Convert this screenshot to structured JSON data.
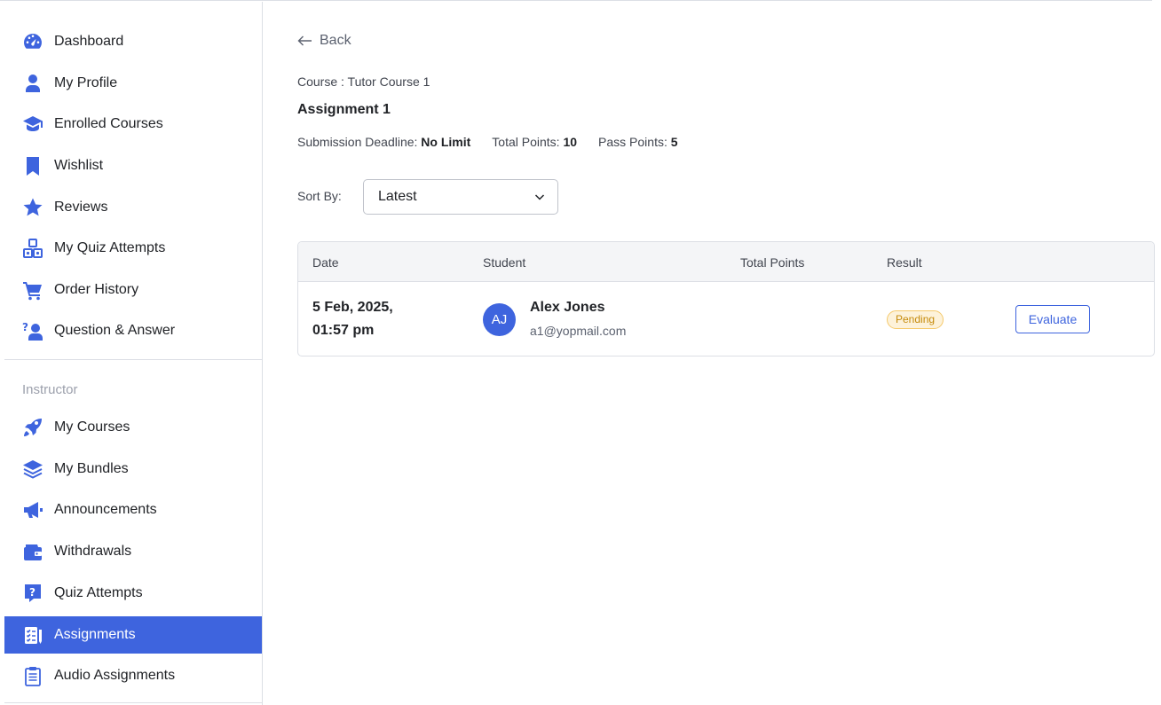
{
  "sidebar": {
    "items": [
      {
        "label": "Dashboard",
        "icon": "dashboard-gauge-icon"
      },
      {
        "label": "My Profile",
        "icon": "user-icon"
      },
      {
        "label": "Enrolled Courses",
        "icon": "graduation-cap-icon"
      },
      {
        "label": "Wishlist",
        "icon": "bookmark-icon"
      },
      {
        "label": "Reviews",
        "icon": "star-icon"
      },
      {
        "label": "My Quiz Attempts",
        "icon": "quiz-blocks-icon"
      },
      {
        "label": "Order History",
        "icon": "cart-icon"
      },
      {
        "label": "Question & Answer",
        "icon": "question-person-icon"
      }
    ],
    "section_label": "Instructor",
    "instructor_items": [
      {
        "label": "My Courses",
        "icon": "rocket-icon"
      },
      {
        "label": "My Bundles",
        "icon": "layers-icon"
      },
      {
        "label": "Announcements",
        "icon": "megaphone-icon"
      },
      {
        "label": "Withdrawals",
        "icon": "wallet-icon"
      },
      {
        "label": "Quiz Attempts",
        "icon": "question-box-icon"
      },
      {
        "label": "Assignments",
        "icon": "assignment-list-icon",
        "active": true
      },
      {
        "label": "Audio Assignments",
        "icon": "clipboard-icon"
      }
    ],
    "active_color": "#3e64de"
  },
  "main": {
    "back_label": "Back",
    "course_line": "Course : Tutor Course 1",
    "assignment_title": "Assignment 1",
    "meta": {
      "deadline_label": "Submission Deadline:",
      "deadline_value": "No Limit",
      "total_points_label": "Total Points:",
      "total_points_value": "10",
      "pass_points_label": "Pass Points:",
      "pass_points_value": "5"
    },
    "sort": {
      "label": "Sort By:",
      "selected": "Latest"
    },
    "table": {
      "headers": [
        "Date",
        "Student",
        "Total Points",
        "Result"
      ],
      "rows": [
        {
          "date_line1": "5 Feb, 2025,",
          "date_line2": "01:57 pm",
          "avatar_initials": "AJ",
          "student_name": "Alex Jones",
          "student_email": "a1@yopmail.com",
          "total_points": "",
          "result": "Pending",
          "action": "Evaluate"
        }
      ]
    }
  }
}
